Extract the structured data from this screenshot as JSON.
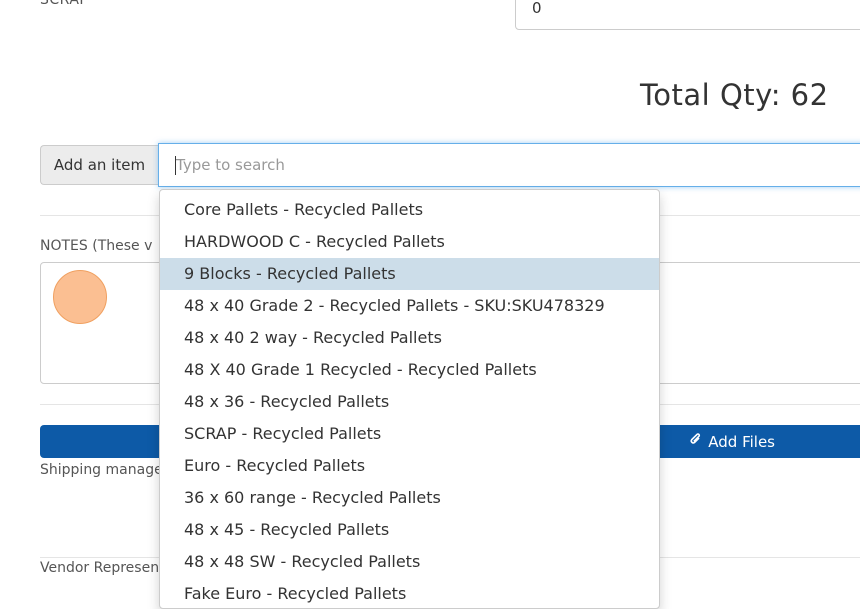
{
  "scrap": {
    "label": "SCRAP",
    "value": "0"
  },
  "total": {
    "text": "Total Qty: 62"
  },
  "add_item": {
    "button_label": "Add an item",
    "search_placeholder": "Type to search"
  },
  "notes": {
    "label": "NOTES (These v"
  },
  "files": {
    "add_label": "Add Files",
    "icon": "paperclip-icon"
  },
  "shipping": {
    "label": "Shipping manage"
  },
  "vendor": {
    "label": "Vendor Represen"
  },
  "dropdown": {
    "active_index": 2,
    "items": [
      "Core Pallets - Recycled Pallets",
      "HARDWOOD C - Recycled Pallets",
      "9 Blocks - Recycled Pallets",
      "48 x 40 Grade 2 - Recycled Pallets - SKU:SKU478329",
      "48 x 40 2 way - Recycled Pallets",
      "48 X 40 Grade 1 Recycled - Recycled Pallets",
      "48 x 36 - Recycled Pallets",
      "SCRAP - Recycled Pallets",
      "Euro - Recycled Pallets",
      "36 x 60 range - Recycled Pallets",
      "48 x 45 - Recycled Pallets",
      "48 x 48 SW - Recycled Pallets",
      "Fake Euro - Recycled Pallets"
    ]
  },
  "colors": {
    "primary_button": "#0d5aa7",
    "active_item": "#ccdde9",
    "focus_border": "#66afe9"
  }
}
